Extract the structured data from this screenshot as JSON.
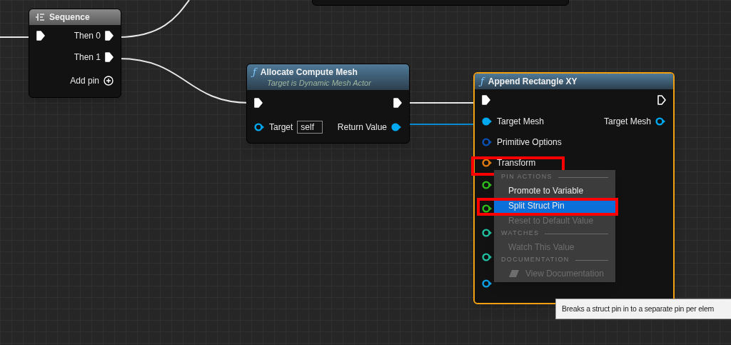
{
  "nodes": [
    {
      "kind": "macro",
      "title": "Sequence",
      "selected": false,
      "inputs": [
        {
          "kind": "exec",
          "connected": true
        }
      ],
      "outputs": [
        {
          "kind": "exec",
          "label": "Then 0",
          "connected": true
        },
        {
          "kind": "exec",
          "label": "Then 1",
          "connected": true
        },
        {
          "kind": "add",
          "label": "Add pin"
        }
      ]
    },
    {
      "kind": "function",
      "glyph": "ƒ",
      "title": "Allocate Compute Mesh",
      "subtitle": "Target is Dynamic Mesh Actor",
      "selected": false,
      "inputs": [
        {
          "kind": "exec",
          "connected": true
        },
        {
          "kind": "data",
          "label": "Target",
          "value": "self",
          "color": "#00a8f0",
          "connected": false
        }
      ],
      "outputs": [
        {
          "kind": "exec",
          "connected": true
        },
        {
          "kind": "data",
          "label": "Return Value",
          "color": "#00a8f0",
          "connected": true
        }
      ]
    },
    {
      "kind": "function",
      "glyph": "ƒ",
      "title": "Append Rectangle XY",
      "selected": true,
      "inputs": [
        {
          "kind": "exec",
          "connected": true
        },
        {
          "kind": "data",
          "label": "Target Mesh",
          "color": "#00a8f0",
          "connected": true
        },
        {
          "kind": "data",
          "label": "Primitive Options",
          "color": "#0b4fb0",
          "connected": false
        },
        {
          "kind": "data",
          "label": "Transform",
          "color": "#e07a10",
          "connected": false
        },
        {
          "kind": "data",
          "color": "#2ec01a",
          "connected": false
        },
        {
          "kind": "data",
          "color": "#2ec01a",
          "connected": false
        },
        {
          "kind": "data",
          "color": "#1fbf9f",
          "connected": false
        },
        {
          "kind": "data",
          "color": "#1fbf9f",
          "connected": false
        },
        {
          "kind": "data",
          "color": "#0aa0e8",
          "connected": false
        }
      ],
      "outputs": [
        {
          "kind": "exec",
          "connected": false
        },
        {
          "kind": "data",
          "label": "Target Mesh",
          "color": "#00a8f0",
          "connected": false
        }
      ]
    }
  ],
  "context_menu": {
    "sections": [
      {
        "heading": "PIN ACTIONS",
        "items": [
          {
            "label": "Promote to Variable",
            "disabled": false,
            "selected": false
          },
          {
            "label": "Split Struct Pin",
            "disabled": false,
            "selected": true
          },
          {
            "label": "Reset to Default Value",
            "disabled": true,
            "selected": false
          }
        ]
      },
      {
        "heading": "WATCHES",
        "items": [
          {
            "label": "Watch This Value",
            "disabled": true,
            "selected": false
          }
        ]
      },
      {
        "heading": "DOCUMENTATION",
        "items": [
          {
            "label": "View Documentation",
            "disabled": true,
            "selected": false,
            "icon": true
          }
        ]
      }
    ]
  },
  "tooltip": "Breaks a struct pin in to a separate pin per elem"
}
